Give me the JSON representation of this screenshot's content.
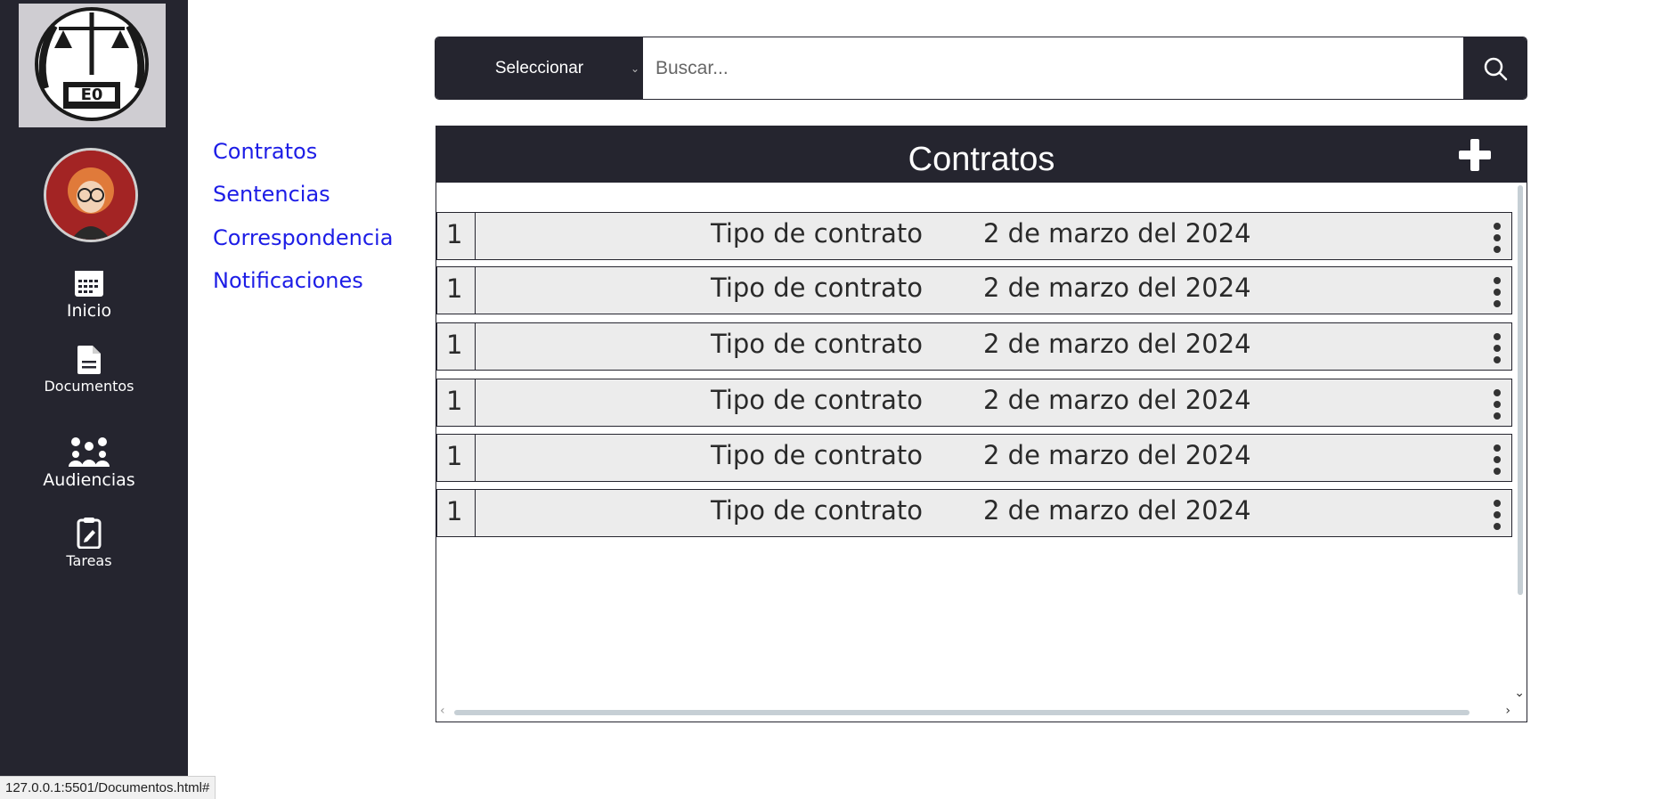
{
  "sidebar": {
    "items": [
      {
        "label": "Inicio",
        "icon": "calendar-icon"
      },
      {
        "label": "Documentos",
        "icon": "document-icon"
      },
      {
        "label": "Audiencias",
        "icon": "people-icon"
      },
      {
        "label": "Tareas",
        "icon": "clipboard-icon"
      }
    ]
  },
  "subnav": {
    "links": [
      "Contratos",
      "Sentencias",
      "Correspondencia",
      "Notificaciones"
    ]
  },
  "search": {
    "select_label": "Seleccionar",
    "placeholder": "Buscar..."
  },
  "panel": {
    "title": "Contratos",
    "rows": [
      {
        "num": "1",
        "type": "Tipo de contrato",
        "date": "2 de marzo del 2024"
      },
      {
        "num": "1",
        "type": "Tipo de contrato",
        "date": "2 de marzo del 2024"
      },
      {
        "num": "1",
        "type": "Tipo de contrato",
        "date": "2 de marzo del 2024"
      },
      {
        "num": "1",
        "type": "Tipo de contrato",
        "date": "2 de marzo del 2024"
      },
      {
        "num": "1",
        "type": "Tipo de contrato",
        "date": "2 de marzo del 2024"
      },
      {
        "num": "1",
        "type": "Tipo de contrato",
        "date": "2 de marzo del 2024"
      }
    ]
  },
  "status_url": "127.0.0.1:5501/Documentos.html#",
  "colors": {
    "sidebar": "#25252f",
    "link": "#1d1de6",
    "row_bg": "#ececec"
  }
}
